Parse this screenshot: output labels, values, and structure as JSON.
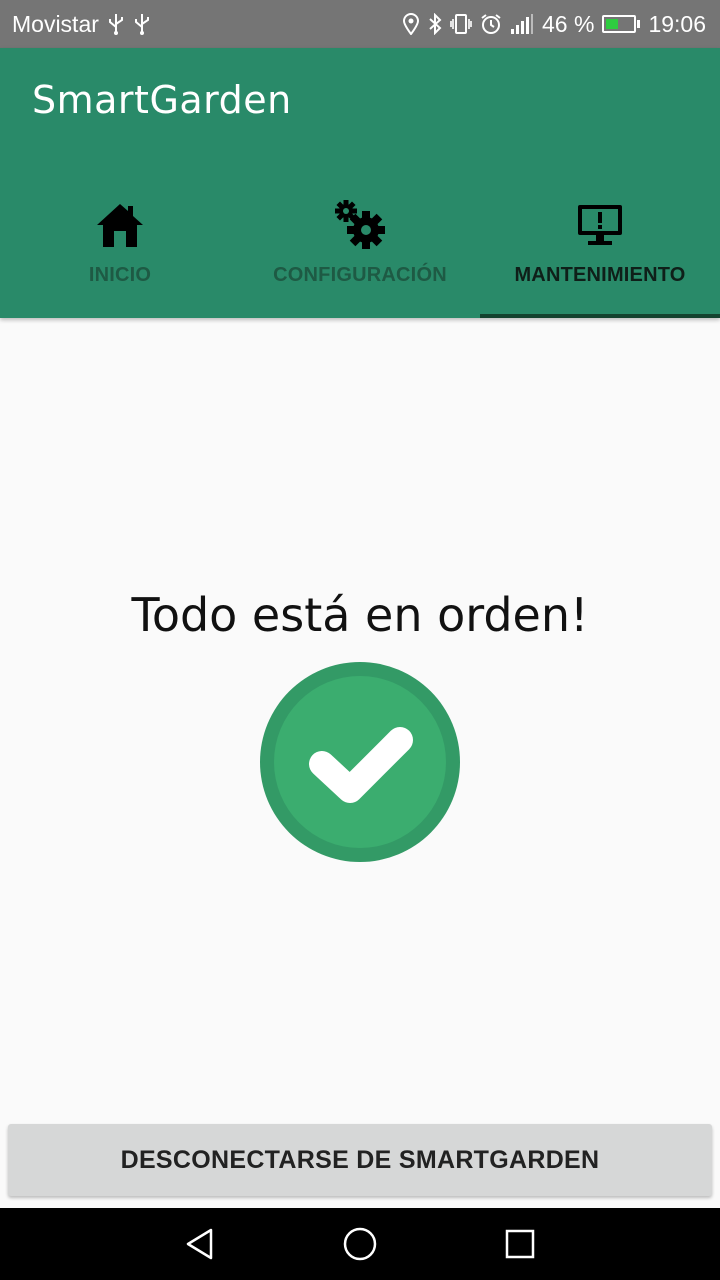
{
  "status_bar": {
    "carrier": "Movistar",
    "battery_percent": "46 %",
    "time": "19:06",
    "icons": [
      "usb-icon",
      "usb-icon",
      "location-icon",
      "bluetooth-icon",
      "vibrate-icon",
      "alarm-icon",
      "signal-icon",
      "battery-charging-icon"
    ]
  },
  "app_bar": {
    "title": "SmartGarden"
  },
  "tabs": [
    {
      "label": "INICIO",
      "icon": "home-icon",
      "active": false
    },
    {
      "label": "CONFIGURACIÓN",
      "icon": "gears-icon",
      "active": false
    },
    {
      "label": "MANTENIMIENTO",
      "icon": "monitor-alert-icon",
      "active": true
    }
  ],
  "main": {
    "message": "Todo está en orden!",
    "status_icon": "check-circle-icon",
    "colors": {
      "accent": "#298a69",
      "check_outer": "#339a66",
      "check_inner": "#3bad6f"
    }
  },
  "footer": {
    "disconnect_label": "DESCONECTARSE DE SMARTGARDEN"
  },
  "nav_bar": {
    "icons": [
      "back-icon",
      "home-circle-icon",
      "recents-icon"
    ]
  }
}
